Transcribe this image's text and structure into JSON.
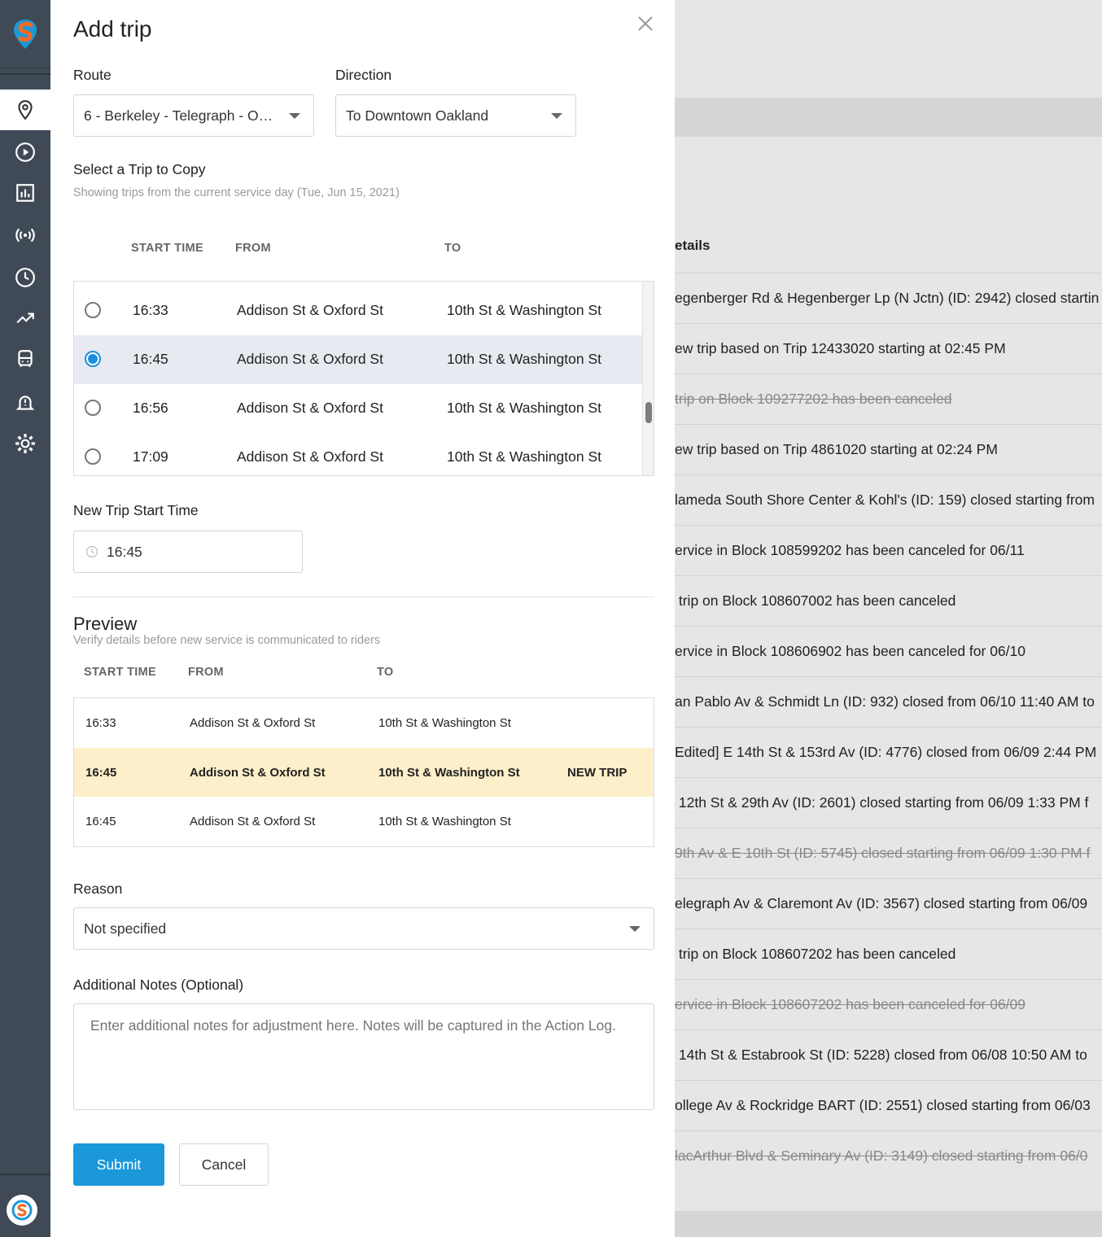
{
  "modal": {
    "title": "Add trip",
    "route_label": "Route",
    "route_value": "6 - Berkeley - Telegraph - Oa...",
    "direction_label": "Direction",
    "direction_value": "To Downtown Oakland",
    "select_trip_label": "Select a Trip to Copy",
    "select_trip_hint": "Showing trips from the current service day (Tue, Jun 15, 2021)",
    "trip_headers": {
      "start": "START TIME",
      "from": "FROM",
      "to": "TO"
    },
    "trips": [
      {
        "start": "16:33",
        "from": "Addison St & Oxford St",
        "to": "10th St & Washington St"
      },
      {
        "start": "16:45",
        "from": "Addison St & Oxford St",
        "to": "10th St & Washington St"
      },
      {
        "start": "16:56",
        "from": "Addison St & Oxford St",
        "to": "10th St & Washington St"
      },
      {
        "start": "17:09",
        "from": "Addison St & Oxford St",
        "to": "10th St & Washington St"
      }
    ],
    "new_start_label": "New Trip Start Time",
    "new_start_value": "16:45",
    "preview_title": "Preview",
    "preview_hint": "Verify details before new service is communicated to riders",
    "preview_headers": {
      "start": "START TIME",
      "from": "FROM",
      "to": "TO"
    },
    "preview_rows": [
      {
        "start": "16:33",
        "from": "Addison St & Oxford St",
        "to": "10th St & Washington St",
        "tag": ""
      },
      {
        "start": "16:45",
        "from": "Addison St & Oxford St",
        "to": "10th St & Washington St",
        "tag": "NEW TRIP"
      },
      {
        "start": "16:45",
        "from": "Addison St & Oxford St",
        "to": "10th St & Washington St",
        "tag": ""
      }
    ],
    "reason_label": "Reason",
    "reason_value": "Not specified",
    "notes_label": "Additional Notes (Optional)",
    "notes_placeholder": "Enter additional notes for adjustment here. Notes will be captured in the Action Log.",
    "submit_label": "Submit",
    "cancel_label": "Cancel"
  },
  "background": {
    "header": "etails",
    "rows": [
      {
        "text": "egenberger Rd & Hegenberger Lp (N Jctn) (ID: 2942) closed startin",
        "strike": false
      },
      {
        "text": "ew trip based on Trip 12433020 starting at 02:45 PM",
        "strike": false
      },
      {
        "text": "trip on Block 109277202 has been canceled",
        "strike": true
      },
      {
        "text": "ew trip based on Trip 4861020 starting at 02:24 PM",
        "strike": false
      },
      {
        "text": "lameda South Shore Center & Kohl's (ID: 159) closed starting from",
        "strike": false
      },
      {
        "text": "ervice in Block 108599202 has been canceled for 06/11",
        "strike": false
      },
      {
        "text": " trip on Block 108607002 has been canceled",
        "strike": false
      },
      {
        "text": "ervice in Block 108606902 has been canceled for 06/10",
        "strike": false
      },
      {
        "text": "an Pablo Av & Schmidt Ln (ID: 932) closed from 06/10 11:40 AM to",
        "strike": false
      },
      {
        "text": "Edited] E 14th St & 153rd Av (ID: 4776) closed from 06/09 2:44 PM",
        "strike": false
      },
      {
        "text": " 12th St & 29th Av (ID: 2601) closed starting from 06/09 1:33 PM f",
        "strike": false
      },
      {
        "text": "9th Av & E 10th St (ID: 5745) closed starting from 06/09 1:30 PM f",
        "strike": true
      },
      {
        "text": "elegraph Av & Claremont Av (ID: 3567) closed starting from 06/09",
        "strike": false
      },
      {
        "text": " trip on Block 108607202 has been canceled",
        "strike": false
      },
      {
        "text": "ervice in Block 108607202 has been canceled for 06/09",
        "strike": true
      },
      {
        "text": " 14th St & Estabrook St (ID: 5228) closed from 06/08 10:50 AM to",
        "strike": false
      },
      {
        "text": "ollege Av & Rockridge BART (ID: 2551) closed starting from 06/03",
        "strike": false
      },
      {
        "text": "lacArthur Blvd & Seminary Av (ID: 3149) closed starting from 06/0",
        "strike": true
      }
    ]
  },
  "sidebar": {
    "items": [
      "map-pin-icon",
      "play-circle-icon",
      "bar-chart-icon",
      "broadcast-icon",
      "clock-icon",
      "trending-up-icon",
      "bus-icon",
      "alert-bell-icon",
      "gear-icon"
    ]
  },
  "colors": {
    "sidebar": "#3f4a56",
    "primary": "#1a98da",
    "selected_row": "#e7ebf1",
    "new_trip_row": "#fcefc9"
  }
}
